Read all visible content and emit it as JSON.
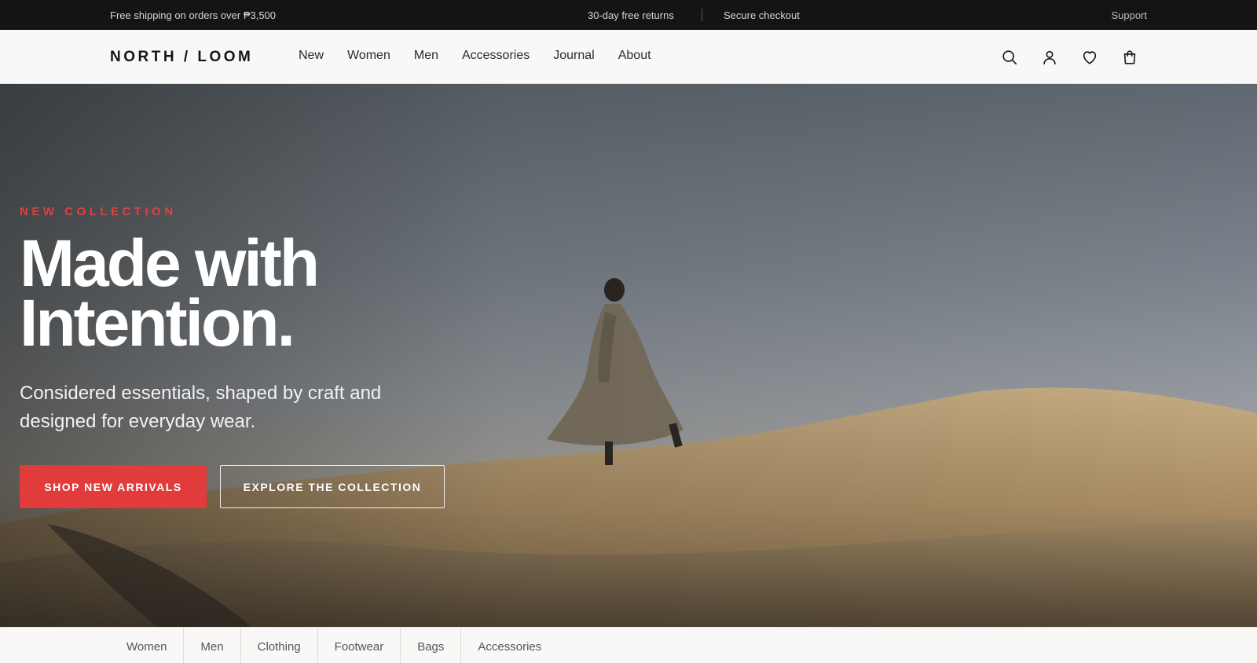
{
  "topbar": {
    "shipping": "Free shipping on orders over ₱3,500",
    "returns": "30-day free returns",
    "secure": "Secure checkout",
    "support": "Support"
  },
  "header": {
    "logo": "NORTH / LOOM",
    "nav": [
      "New",
      "Women",
      "Men",
      "Accessories",
      "Journal",
      "About"
    ],
    "icons": [
      "search-icon",
      "account-icon",
      "heart-icon",
      "bag-icon"
    ]
  },
  "hero": {
    "eyebrow": "NEW COLLECTION",
    "headline_line1": "Made with",
    "headline_line2": "Intention.",
    "subtitle": "Considered essentials, shaped by craft and designed for everyday wear.",
    "primary_cta": "SHOP NEW ARRIVALS",
    "secondary_cta": "EXPLORE THE COLLECTION"
  },
  "categories": [
    "Women",
    "Men",
    "Clothing",
    "Footwear",
    "Bags",
    "Accessories"
  ],
  "colors": {
    "accent": "#e23b3b",
    "eyebrow": "#e0413f",
    "topbar_bg": "#141414",
    "header_bg": "#f9f8f6"
  }
}
